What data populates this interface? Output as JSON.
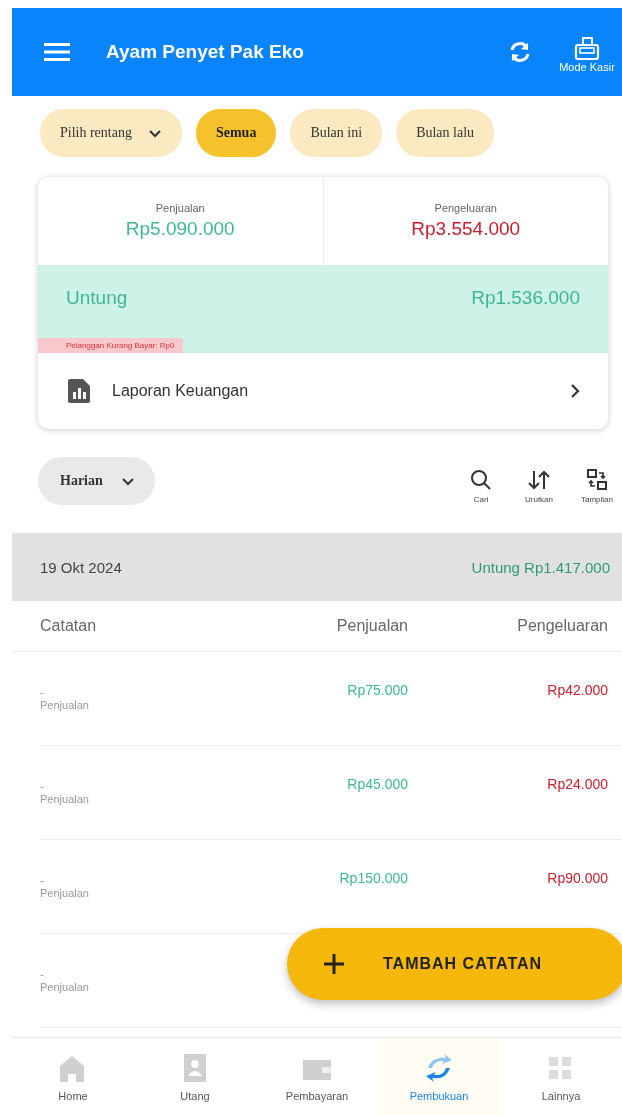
{
  "app_bar": {
    "title": "Ayam Penyet Pak Eko",
    "cashier_label": "Mode Kasir"
  },
  "range_chips": [
    {
      "label": "Pilih rentang",
      "kind": "dropdown",
      "selected": false
    },
    {
      "label": "Semua",
      "kind": "chip",
      "selected": true
    },
    {
      "label": "Bulan ini",
      "kind": "chip",
      "selected": false
    },
    {
      "label": "Bulan lalu",
      "kind": "chip",
      "selected": false
    }
  ],
  "summary": {
    "sales_label": "Penjualan",
    "sales": "Rp5.090.000",
    "expense_label": "Pengeluaran",
    "expense": "Rp3.554.000",
    "profit_label": "Untung",
    "profit": "Rp1.536.000",
    "debt_note": "Pelanggan Kurang Bayar: Rp0",
    "report_link": "Laporan Keuangan"
  },
  "toolbar": {
    "period": "Harian",
    "actions": [
      {
        "kind": "search",
        "label": "Cari"
      },
      {
        "kind": "sort",
        "label": "Urutkan"
      },
      {
        "kind": "view",
        "label": "Tampilan"
      }
    ]
  },
  "day": {
    "date": "19 Okt 2024",
    "total": "Untung Rp1.417.000"
  },
  "table": {
    "columns": [
      "Catatan",
      "Penjualan",
      "Pengeluaran"
    ],
    "rows": [
      {
        "note": "-",
        "category": "Penjualan",
        "sales": "Rp75.000",
        "expense": "Rp42.000"
      },
      {
        "note": "-",
        "category": "Penjualan",
        "sales": "Rp45.000",
        "expense": "Rp24.000"
      },
      {
        "note": "-",
        "category": "Penjualan",
        "sales": "Rp150.000",
        "expense": "Rp90.000"
      },
      {
        "note": "-",
        "category": "Penjualan"
      }
    ]
  },
  "fab": {
    "label": "TAMBAH CATATAN"
  },
  "bottom_nav": [
    {
      "kind": "home",
      "label": "Home",
      "selected": false
    },
    {
      "kind": "debt",
      "label": "Utang",
      "selected": false
    },
    {
      "kind": "payment",
      "label": "Pembayaran",
      "selected": false
    },
    {
      "kind": "books",
      "label": "Pembukuan",
      "selected": true
    },
    {
      "kind": "more",
      "label": "Lainnya",
      "selected": false
    }
  ]
}
